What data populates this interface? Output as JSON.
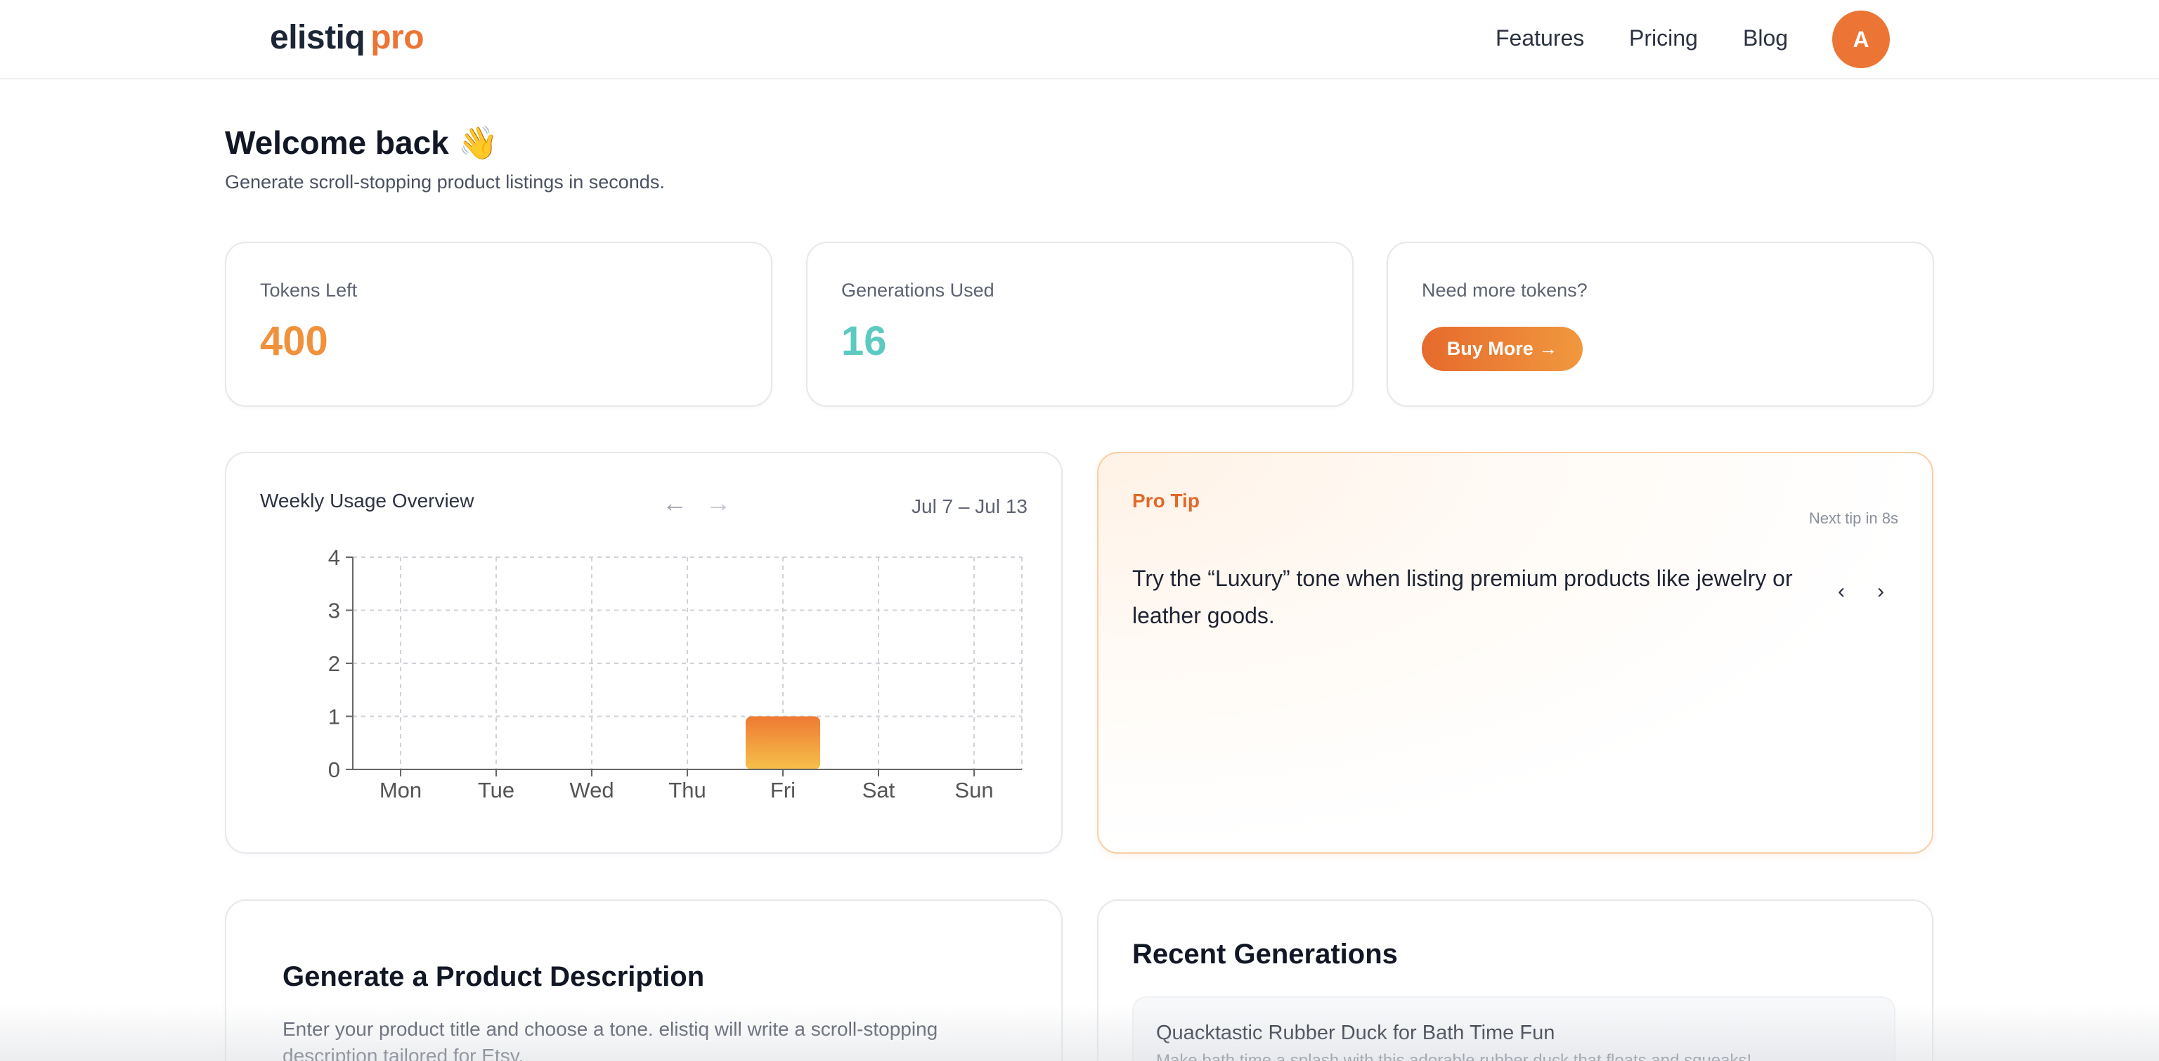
{
  "header": {
    "logo_main": "elistiq",
    "logo_accent": "pro",
    "nav": [
      "Features",
      "Pricing",
      "Blog"
    ],
    "avatar_initial": "A"
  },
  "welcome": {
    "title": "Welcome back 👋",
    "subtitle": "Generate scroll-stopping product listings in seconds."
  },
  "stats": {
    "tokens_label": "Tokens Left",
    "tokens_value": "400",
    "generations_label": "Generations Used",
    "generations_value": "16",
    "more_label": "Need more tokens?",
    "buy_label": "Buy More →"
  },
  "colors": {
    "accent": "#ec7434",
    "tokens": "#f0913c",
    "generations": "#5ccac0"
  },
  "usage": {
    "title": "Weekly Usage Overview",
    "prev_icon": "←",
    "next_icon": "→",
    "range": "Jul 7 – Jul 13"
  },
  "chart_data": {
    "type": "bar",
    "categories": [
      "Mon",
      "Tue",
      "Wed",
      "Thu",
      "Fri",
      "Sat",
      "Sun"
    ],
    "values": [
      0,
      0,
      0,
      0,
      1,
      0,
      0
    ],
    "yticks": [
      0,
      1,
      2,
      3,
      4
    ],
    "ylim": [
      0,
      4
    ],
    "grid": true
  },
  "tip": {
    "label": "Pro Tip",
    "next": "Next tip in 8s",
    "text": "Try the “Luxury” tone when listing premium products like jewelry or leather goods.",
    "prev_icon": "‹",
    "next_icon": "›"
  },
  "generate": {
    "title": "Generate a Product Description",
    "description": "Enter your product title and choose a tone. elistiq will write a scroll-stopping description tailored for Etsy."
  },
  "recent": {
    "title": "Recent Generations",
    "items": [
      {
        "title": "Quacktastic Rubber Duck for Bath Time Fun",
        "description": "Make bath time a splash with this adorable rubber duck that floats and squeaks!"
      }
    ]
  }
}
